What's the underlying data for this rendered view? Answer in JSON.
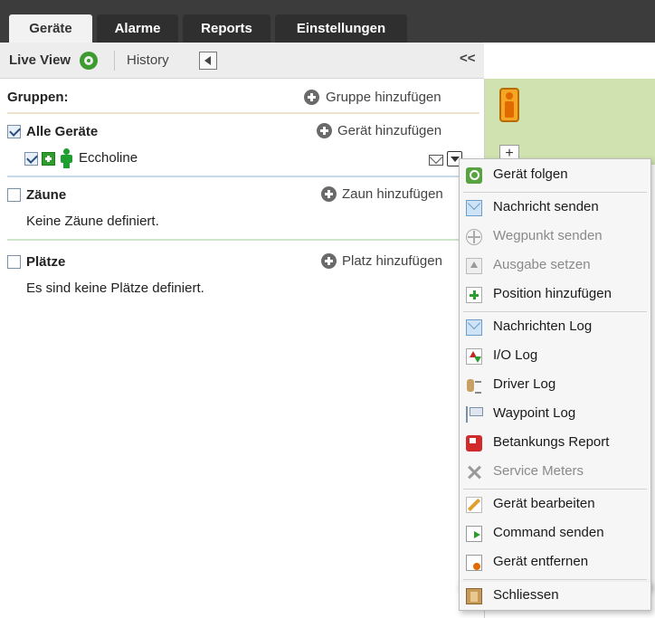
{
  "tabs": [
    {
      "label": "Geräte",
      "active": true
    },
    {
      "label": "Alarme",
      "active": false
    },
    {
      "label": "Reports",
      "active": false
    },
    {
      "label": "Einstellungen",
      "active": false
    }
  ],
  "viewbar": {
    "live_view": "Live View",
    "history": "History",
    "collapse": "<<"
  },
  "groups": {
    "header": "Gruppen:",
    "add_group": "Gruppe hinzufügen",
    "all_devices": {
      "label": "Alle Geräte",
      "checked": true,
      "add_device": "Gerät hinzufügen"
    },
    "device": {
      "name": "Eccholine",
      "checked": true
    }
  },
  "fences": {
    "label": "Zäune",
    "checked": false,
    "add": "Zaun hinzufügen",
    "empty": "Keine Zäune definiert."
  },
  "places": {
    "label": "Plätze",
    "checked": false,
    "add": "Platz hinzufügen",
    "empty": "Es sind keine Plätze definiert."
  },
  "map": {
    "zoom_in": "+"
  },
  "context_menu": {
    "items": [
      {
        "label": "Gerät folgen",
        "icon": "search-icon",
        "enabled": true
      },
      {
        "label": "Nachricht senden",
        "icon": "mail-icon",
        "enabled": true
      },
      {
        "label": "Wegpunkt senden",
        "icon": "crosshair-icon",
        "enabled": false
      },
      {
        "label": "Ausgabe setzen",
        "icon": "output-icon",
        "enabled": false
      },
      {
        "label": "Position hinzufügen",
        "icon": "add-icon",
        "enabled": true
      },
      {
        "label": "Nachrichten Log",
        "icon": "mail-icon",
        "enabled": true
      },
      {
        "label": "I/O Log",
        "icon": "io-icon",
        "enabled": true
      },
      {
        "label": "Driver Log",
        "icon": "driver-icon",
        "enabled": true
      },
      {
        "label": "Waypoint Log",
        "icon": "flag-icon",
        "enabled": true
      },
      {
        "label": "Betankungs Report",
        "icon": "fuel-icon",
        "enabled": true
      },
      {
        "label": "Service Meters",
        "icon": "tools-icon",
        "enabled": false
      },
      {
        "label": "Gerät bearbeiten",
        "icon": "edit-icon",
        "enabled": true
      },
      {
        "label": "Command senden",
        "icon": "command-icon",
        "enabled": true,
        "highlighted": true
      },
      {
        "label": "Gerät entfernen",
        "icon": "remove-icon",
        "enabled": true
      },
      {
        "label": "Schliessen",
        "icon": "exit-icon",
        "enabled": true
      }
    ]
  },
  "colors": {
    "tabbar_bg": "#3c3c3c",
    "highlight": "#f5f53b",
    "map_green": "#cfe2b0"
  }
}
